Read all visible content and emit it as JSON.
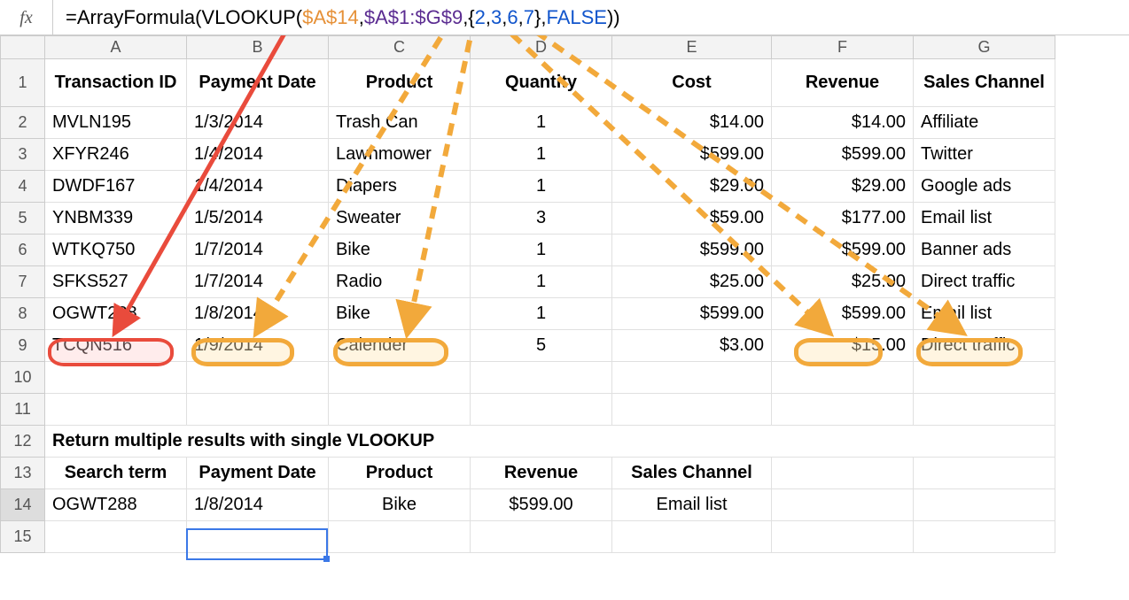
{
  "formula_bar": {
    "fx_label": "fx",
    "prefix": "=ArrayFormula(VLOOKUP(",
    "ref1": "$A$14",
    "sep1": ",",
    "ref2": "$A$1:$G$9",
    "sep2": ",{",
    "n1": "2",
    "c1": ",",
    "n2": "3",
    "c2": ",",
    "n3": "6",
    "c3": ",",
    "n4": "7",
    "sep3": "},",
    "false_kw": "FALSE",
    "suffix": "))"
  },
  "columns": [
    "A",
    "B",
    "C",
    "D",
    "E",
    "F",
    "G"
  ],
  "row_labels": [
    "1",
    "2",
    "3",
    "4",
    "5",
    "6",
    "7",
    "8",
    "9",
    "10",
    "11",
    "12",
    "13",
    "14",
    "15"
  ],
  "headers": {
    "A": "Transaction ID",
    "B": "Payment Date",
    "C": "Product",
    "D": "Quantity",
    "E": "Cost",
    "F": "Revenue",
    "G": "Sales Channel"
  },
  "rows": {
    "2": {
      "A": "MVLN195",
      "B": "1/3/2014",
      "C": "Trash Can",
      "D": "1",
      "E": "$14.00",
      "F": "$14.00",
      "G": "Affiliate"
    },
    "3": {
      "A": "XFYR246",
      "B": "1/4/2014",
      "C": "Lawnmower",
      "D": "1",
      "E": "$599.00",
      "F": "$599.00",
      "G": "Twitter"
    },
    "4": {
      "A": "DWDF167",
      "B": "1/4/2014",
      "C": "Diapers",
      "D": "1",
      "E": "$29.00",
      "F": "$29.00",
      "G": "Google ads"
    },
    "5": {
      "A": "YNBM339",
      "B": "1/5/2014",
      "C": "Sweater",
      "D": "3",
      "E": "$59.00",
      "F": "$177.00",
      "G": "Email list"
    },
    "6": {
      "A": "WTKQ750",
      "B": "1/7/2014",
      "C": "Bike",
      "D": "1",
      "E": "$599.00",
      "F": "$599.00",
      "G": "Banner ads"
    },
    "7": {
      "A": "SFKS527",
      "B": "1/7/2014",
      "C": "Radio",
      "D": "1",
      "E": "$25.00",
      "F": "$25.00",
      "G": "Direct traffic"
    },
    "8": {
      "A": "OGWT288",
      "B": "1/8/2014",
      "C": "Bike",
      "D": "1",
      "E": "$599.00",
      "F": "$599.00",
      "G": "Email list"
    },
    "9": {
      "A": "TCQN516",
      "B": "1/9/2014",
      "C": "Calender",
      "D": "5",
      "E": "$3.00",
      "F": "$15.00",
      "G": "Direct traffic"
    }
  },
  "section_title": "Return multiple results with single VLOOKUP",
  "headers2": {
    "A": "Search term",
    "B": "Payment Date",
    "C": "Product",
    "D": "Revenue",
    "E": "Sales Channel"
  },
  "result_row": {
    "A": "OGWT288",
    "B": "1/8/2014",
    "C": "Bike",
    "D": "$599.00",
    "E": "Email list"
  }
}
